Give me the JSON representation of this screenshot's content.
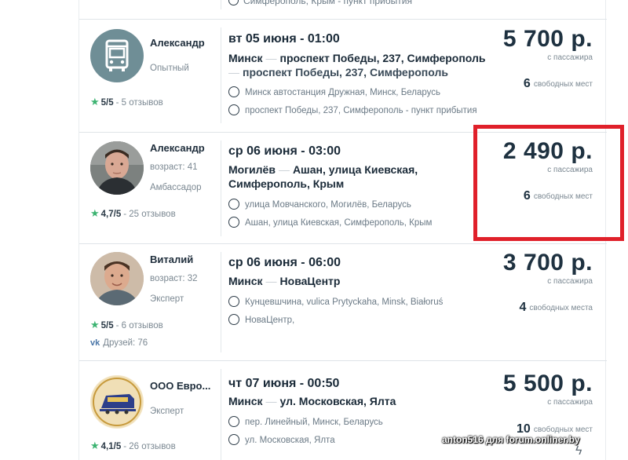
{
  "top_strip": {
    "stop": "Симферополь, Крым - пункт прибытия"
  },
  "trips": [
    {
      "driver": {
        "name": "Александр",
        "sub1": "Опытный",
        "sub2": "",
        "rating": "5/5",
        "reviews": "- 5 отзывов",
        "avatar": "bus-icon"
      },
      "date": "вт 05 июня - 01:00",
      "route_line1": {
        "from": "Минск",
        "to": "проспект Победы, 237, Симферополь"
      },
      "route_line2": "проспект Победы, 237, Симферополь",
      "stops": [
        "Минск автостанция Дружная, Минск, Беларусь",
        "проспект Победы, 237, Симферополь - пункт прибытия"
      ],
      "price": "5 700 р.",
      "per": "с пассажира",
      "seats_count": "6",
      "seats_label": "свободных мест"
    },
    {
      "driver": {
        "name": "Александр",
        "sub1": "возраст: 41",
        "sub2": "Амбассадор",
        "rating": "4,7/5",
        "reviews": "- 25 отзывов",
        "avatar": "man-photo"
      },
      "date": "ср 06 июня - 03:00",
      "route_line1": {
        "from": "Могилёв",
        "to": "Ашан, улица Киевская,"
      },
      "route_line2": "Симферополь, Крым",
      "stops": [
        "улица Мовчанского, Могилёв, Беларусь",
        "Ашан, улица Киевская, Симферополь, Крым"
      ],
      "price": "2 490 р.",
      "per": "с пассажира",
      "seats_count": "6",
      "seats_label": "свободных мест"
    },
    {
      "driver": {
        "name": "Виталий",
        "sub1": "возраст: 32",
        "sub2": "Эксперт",
        "rating": "5/5",
        "reviews": "- 6 отзывов",
        "friends": "Друзей: 76",
        "avatar": "man-photo"
      },
      "date": "ср 06 июня - 06:00",
      "route_line1": {
        "from": "Минск",
        "to": "НоваЦентр"
      },
      "route_line2": "",
      "stops": [
        "Кунцевшчина, vulica Prytyckaha, Minsk, Białoruś",
        "НоваЦентр,"
      ],
      "price": "3 700 р.",
      "per": "с пассажира",
      "seats_count": "4",
      "seats_label": "свободных места"
    },
    {
      "driver": {
        "name": "ООО Евро...",
        "sub1": "Эксперт",
        "sub2": "",
        "rating": "4,1/5",
        "reviews": "- 26 отзывов",
        "avatar": "train-logo"
      },
      "date": "чт 07 июня - 00:50",
      "route_line1": {
        "from": "Минск",
        "to": "ул. Московская, Ялта"
      },
      "route_line2": "",
      "stops": [
        "пер. Линейный, Минск, Беларусь",
        "ул. Московская, Ялта"
      ],
      "price": "5 500 р.",
      "per": "с пассажира",
      "seats_count": "10",
      "seats_label": "свободных мест"
    }
  ],
  "watermark": "anton516 для forum.onliner.by",
  "colors": {
    "highlight": "#e0202a",
    "star": "#3cb371",
    "text_dark": "#1e3140"
  }
}
